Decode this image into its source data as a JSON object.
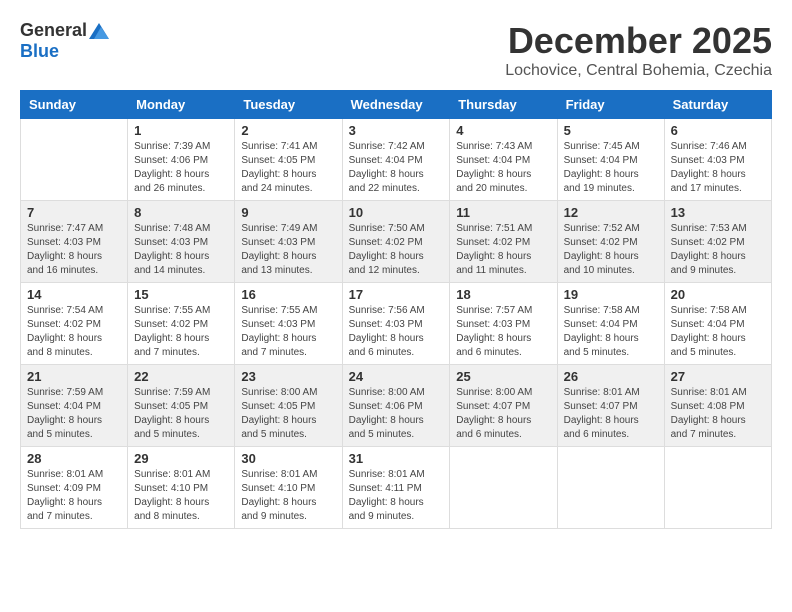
{
  "header": {
    "logo_general": "General",
    "logo_blue": "Blue",
    "month_title": "December 2025",
    "location": "Lochovice, Central Bohemia, Czechia"
  },
  "days_of_week": [
    "Sunday",
    "Monday",
    "Tuesday",
    "Wednesday",
    "Thursday",
    "Friday",
    "Saturday"
  ],
  "weeks": [
    [
      {
        "day": "",
        "info": ""
      },
      {
        "day": "1",
        "info": "Sunrise: 7:39 AM\nSunset: 4:06 PM\nDaylight: 8 hours\nand 26 minutes."
      },
      {
        "day": "2",
        "info": "Sunrise: 7:41 AM\nSunset: 4:05 PM\nDaylight: 8 hours\nand 24 minutes."
      },
      {
        "day": "3",
        "info": "Sunrise: 7:42 AM\nSunset: 4:04 PM\nDaylight: 8 hours\nand 22 minutes."
      },
      {
        "day": "4",
        "info": "Sunrise: 7:43 AM\nSunset: 4:04 PM\nDaylight: 8 hours\nand 20 minutes."
      },
      {
        "day": "5",
        "info": "Sunrise: 7:45 AM\nSunset: 4:04 PM\nDaylight: 8 hours\nand 19 minutes."
      },
      {
        "day": "6",
        "info": "Sunrise: 7:46 AM\nSunset: 4:03 PM\nDaylight: 8 hours\nand 17 minutes."
      }
    ],
    [
      {
        "day": "7",
        "info": "Sunrise: 7:47 AM\nSunset: 4:03 PM\nDaylight: 8 hours\nand 16 minutes."
      },
      {
        "day": "8",
        "info": "Sunrise: 7:48 AM\nSunset: 4:03 PM\nDaylight: 8 hours\nand 14 minutes."
      },
      {
        "day": "9",
        "info": "Sunrise: 7:49 AM\nSunset: 4:03 PM\nDaylight: 8 hours\nand 13 minutes."
      },
      {
        "day": "10",
        "info": "Sunrise: 7:50 AM\nSunset: 4:02 PM\nDaylight: 8 hours\nand 12 minutes."
      },
      {
        "day": "11",
        "info": "Sunrise: 7:51 AM\nSunset: 4:02 PM\nDaylight: 8 hours\nand 11 minutes."
      },
      {
        "day": "12",
        "info": "Sunrise: 7:52 AM\nSunset: 4:02 PM\nDaylight: 8 hours\nand 10 minutes."
      },
      {
        "day": "13",
        "info": "Sunrise: 7:53 AM\nSunset: 4:02 PM\nDaylight: 8 hours\nand 9 minutes."
      }
    ],
    [
      {
        "day": "14",
        "info": "Sunrise: 7:54 AM\nSunset: 4:02 PM\nDaylight: 8 hours\nand 8 minutes."
      },
      {
        "day": "15",
        "info": "Sunrise: 7:55 AM\nSunset: 4:02 PM\nDaylight: 8 hours\nand 7 minutes."
      },
      {
        "day": "16",
        "info": "Sunrise: 7:55 AM\nSunset: 4:03 PM\nDaylight: 8 hours\nand 7 minutes."
      },
      {
        "day": "17",
        "info": "Sunrise: 7:56 AM\nSunset: 4:03 PM\nDaylight: 8 hours\nand 6 minutes."
      },
      {
        "day": "18",
        "info": "Sunrise: 7:57 AM\nSunset: 4:03 PM\nDaylight: 8 hours\nand 6 minutes."
      },
      {
        "day": "19",
        "info": "Sunrise: 7:58 AM\nSunset: 4:04 PM\nDaylight: 8 hours\nand 5 minutes."
      },
      {
        "day": "20",
        "info": "Sunrise: 7:58 AM\nSunset: 4:04 PM\nDaylight: 8 hours\nand 5 minutes."
      }
    ],
    [
      {
        "day": "21",
        "info": "Sunrise: 7:59 AM\nSunset: 4:04 PM\nDaylight: 8 hours\nand 5 minutes."
      },
      {
        "day": "22",
        "info": "Sunrise: 7:59 AM\nSunset: 4:05 PM\nDaylight: 8 hours\nand 5 minutes."
      },
      {
        "day": "23",
        "info": "Sunrise: 8:00 AM\nSunset: 4:05 PM\nDaylight: 8 hours\nand 5 minutes."
      },
      {
        "day": "24",
        "info": "Sunrise: 8:00 AM\nSunset: 4:06 PM\nDaylight: 8 hours\nand 5 minutes."
      },
      {
        "day": "25",
        "info": "Sunrise: 8:00 AM\nSunset: 4:07 PM\nDaylight: 8 hours\nand 6 minutes."
      },
      {
        "day": "26",
        "info": "Sunrise: 8:01 AM\nSunset: 4:07 PM\nDaylight: 8 hours\nand 6 minutes."
      },
      {
        "day": "27",
        "info": "Sunrise: 8:01 AM\nSunset: 4:08 PM\nDaylight: 8 hours\nand 7 minutes."
      }
    ],
    [
      {
        "day": "28",
        "info": "Sunrise: 8:01 AM\nSunset: 4:09 PM\nDaylight: 8 hours\nand 7 minutes."
      },
      {
        "day": "29",
        "info": "Sunrise: 8:01 AM\nSunset: 4:10 PM\nDaylight: 8 hours\nand 8 minutes."
      },
      {
        "day": "30",
        "info": "Sunrise: 8:01 AM\nSunset: 4:10 PM\nDaylight: 8 hours\nand 9 minutes."
      },
      {
        "day": "31",
        "info": "Sunrise: 8:01 AM\nSunset: 4:11 PM\nDaylight: 8 hours\nand 9 minutes."
      },
      {
        "day": "",
        "info": ""
      },
      {
        "day": "",
        "info": ""
      },
      {
        "day": "",
        "info": ""
      }
    ]
  ]
}
